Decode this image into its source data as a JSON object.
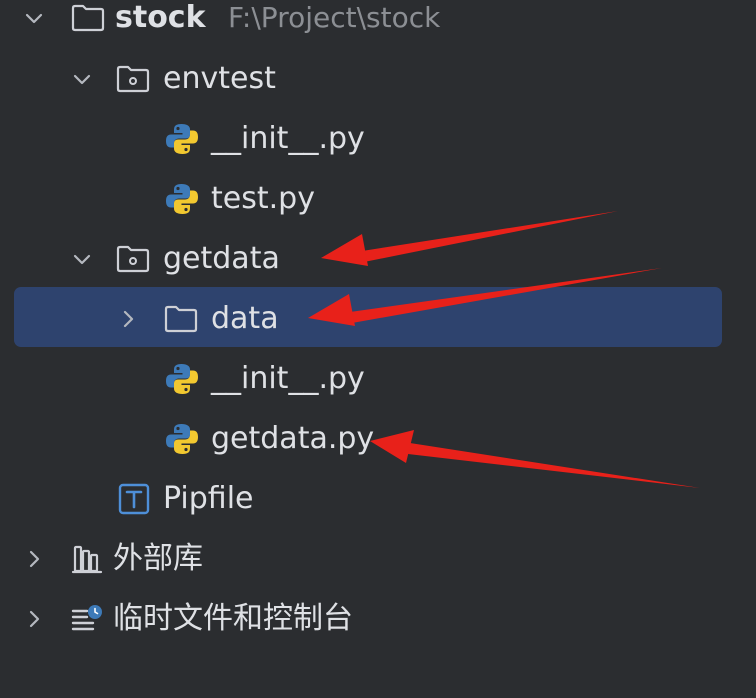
{
  "project_tree": {
    "root": {
      "name": "stock",
      "path": "F:\\Project\\stock",
      "expanded": true
    },
    "items": [
      {
        "name": "envtest",
        "type": "package-folder",
        "expanded": true
      },
      {
        "name": "__init__.py",
        "type": "python-file"
      },
      {
        "name": "test.py",
        "type": "python-file"
      },
      {
        "name": "getdata",
        "type": "package-folder",
        "expanded": true
      },
      {
        "name": "data",
        "type": "folder",
        "expanded": false,
        "selected": true
      },
      {
        "name": "__init__.py",
        "type": "python-file"
      },
      {
        "name": "getdata.py",
        "type": "python-file"
      },
      {
        "name": "Pipfile",
        "type": "text-file"
      },
      {
        "name": "外部库",
        "type": "external-libraries",
        "expanded": false
      },
      {
        "name": "临时文件和控制台",
        "type": "scratches-and-consoles",
        "expanded": false
      }
    ]
  },
  "colors": {
    "background": "#2b2d30",
    "selection": "#2e436e",
    "text": "#dfe1e5",
    "path_text": "#8c8f94",
    "annotation_arrow": "#e8211a",
    "python_blue": "#3d7ab8",
    "python_yellow": "#f2c830",
    "text_file_icon": "#4e8fd8"
  }
}
